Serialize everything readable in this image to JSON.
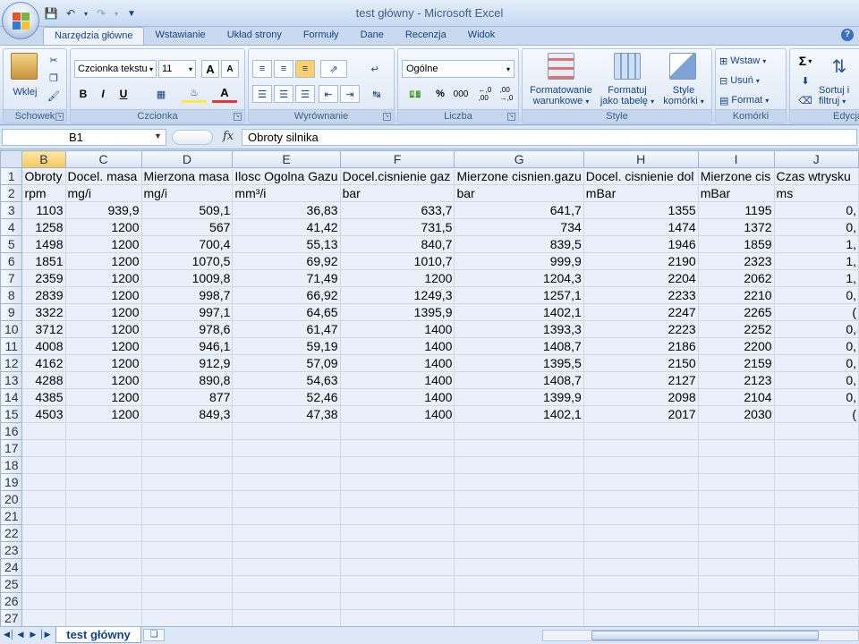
{
  "window": {
    "title": "test główny - Microsoft Excel"
  },
  "ribbon": {
    "tabs": [
      "Narzędzia główne",
      "Wstawianie",
      "Układ strony",
      "Formuły",
      "Dane",
      "Recenzja",
      "Widok"
    ],
    "clipboard": {
      "paste_label": "Wklej",
      "group_label": "Schowek"
    },
    "font": {
      "font_name": "Czcionka tekstu",
      "font_size": "11",
      "grow": "A",
      "shrink": "A",
      "bold": "B",
      "italic": "I",
      "underline": "U",
      "color_letter": "A",
      "group_label": "Czcionka"
    },
    "alignment": {
      "group_label": "Wyrównanie"
    },
    "number": {
      "format": "Ogólne",
      "percent": "%",
      "thousands": "000",
      "inc_dec": "←,0\n,00",
      "dec_dec": ",00\n→,0",
      "group_label": "Liczba"
    },
    "styles": {
      "conditional_line1": "Formatowanie",
      "conditional_line2": "warunkowe",
      "table_line1": "Formatuj",
      "table_line2": "jako tabelę",
      "cell_line1": "Style",
      "cell_line2": "komórki",
      "group_label": "Style"
    },
    "cells": {
      "insert": "Wstaw",
      "delete": "Usuń",
      "format": "Format",
      "group_label": "Komórki"
    },
    "editing": {
      "sigma": "Σ",
      "sort_line1": "Sortuj i",
      "sort_line2": "filtruj",
      "group_label": "Edycja"
    }
  },
  "formula_bar": {
    "name_box": "B1",
    "fx": "fx",
    "value": "Obroty silnika"
  },
  "colors": {
    "accent": "#15428b",
    "grid_fill": "#eaf0fa",
    "header_selected": "#f7c65c"
  },
  "grid": {
    "columns": [
      "B",
      "C",
      "D",
      "E",
      "F",
      "G",
      "H",
      "I",
      "J"
    ],
    "selected_column": "B",
    "rows": [
      [
        "1",
        "Obroty",
        "Docel. masa",
        "Mierzona masa",
        "Ilosc Ogolna Gazu",
        "Docel.cisnienie gaz",
        "Mierzone cisnien.gazu",
        "Docel. cisnienie dol",
        "Mierzone cis",
        "Czas wtrysku"
      ],
      [
        "2",
        "rpm",
        "mg/i",
        "mg/i",
        "mm³/i",
        "bar",
        "bar",
        "mBar",
        "mBar",
        "ms"
      ],
      [
        "3",
        "1103",
        "939,9",
        "509,1",
        "36,83",
        "633,7",
        "641,7",
        "1355",
        "1195",
        "0,"
      ],
      [
        "4",
        "1258",
        "1200",
        "567",
        "41,42",
        "731,5",
        "734",
        "1474",
        "1372",
        "0,"
      ],
      [
        "5",
        "1498",
        "1200",
        "700,4",
        "55,13",
        "840,7",
        "839,5",
        "1946",
        "1859",
        "1,"
      ],
      [
        "6",
        "1851",
        "1200",
        "1070,5",
        "69,92",
        "1010,7",
        "999,9",
        "2190",
        "2323",
        "1,"
      ],
      [
        "7",
        "2359",
        "1200",
        "1009,8",
        "71,49",
        "1200",
        "1204,3",
        "2204",
        "2062",
        "1,"
      ],
      [
        "8",
        "2839",
        "1200",
        "998,7",
        "66,92",
        "1249,3",
        "1257,1",
        "2233",
        "2210",
        "0,"
      ],
      [
        "9",
        "3322",
        "1200",
        "997,1",
        "64,65",
        "1395,9",
        "1402,1",
        "2247",
        "2265",
        "("
      ],
      [
        "10",
        "3712",
        "1200",
        "978,6",
        "61,47",
        "1400",
        "1393,3",
        "2223",
        "2252",
        "0,"
      ],
      [
        "11",
        "4008",
        "1200",
        "946,1",
        "59,19",
        "1400",
        "1408,7",
        "2186",
        "2200",
        "0,"
      ],
      [
        "12",
        "4162",
        "1200",
        "912,9",
        "57,09",
        "1400",
        "1395,5",
        "2150",
        "2159",
        "0,"
      ],
      [
        "13",
        "4288",
        "1200",
        "890,8",
        "54,63",
        "1400",
        "1408,7",
        "2127",
        "2123",
        "0,"
      ],
      [
        "14",
        "4385",
        "1200",
        "877",
        "52,46",
        "1400",
        "1399,9",
        "2098",
        "2104",
        "0,"
      ],
      [
        "15",
        "4503",
        "1200",
        "849,3",
        "47,38",
        "1400",
        "1402,1",
        "2017",
        "2030",
        "("
      ],
      [
        "16",
        "",
        "",
        "",
        "",
        "",
        "",
        "",
        "",
        ""
      ],
      [
        "17",
        "",
        "",
        "",
        "",
        "",
        "",
        "",
        "",
        ""
      ],
      [
        "18",
        "",
        "",
        "",
        "",
        "",
        "",
        "",
        "",
        ""
      ],
      [
        "19",
        "",
        "",
        "",
        "",
        "",
        "",
        "",
        "",
        ""
      ],
      [
        "20",
        "",
        "",
        "",
        "",
        "",
        "",
        "",
        "",
        ""
      ],
      [
        "21",
        "",
        "",
        "",
        "",
        "",
        "",
        "",
        "",
        ""
      ],
      [
        "22",
        "",
        "",
        "",
        "",
        "",
        "",
        "",
        "",
        ""
      ],
      [
        "23",
        "",
        "",
        "",
        "",
        "",
        "",
        "",
        "",
        ""
      ],
      [
        "24",
        "",
        "",
        "",
        "",
        "",
        "",
        "",
        "",
        ""
      ],
      [
        "25",
        "",
        "",
        "",
        "",
        "",
        "",
        "",
        "",
        ""
      ],
      [
        "26",
        "",
        "",
        "",
        "",
        "",
        "",
        "",
        "",
        ""
      ],
      [
        "27",
        "",
        "",
        "",
        "",
        "",
        "",
        "",
        "",
        ""
      ]
    ]
  },
  "sheets": {
    "active": "test główny"
  }
}
